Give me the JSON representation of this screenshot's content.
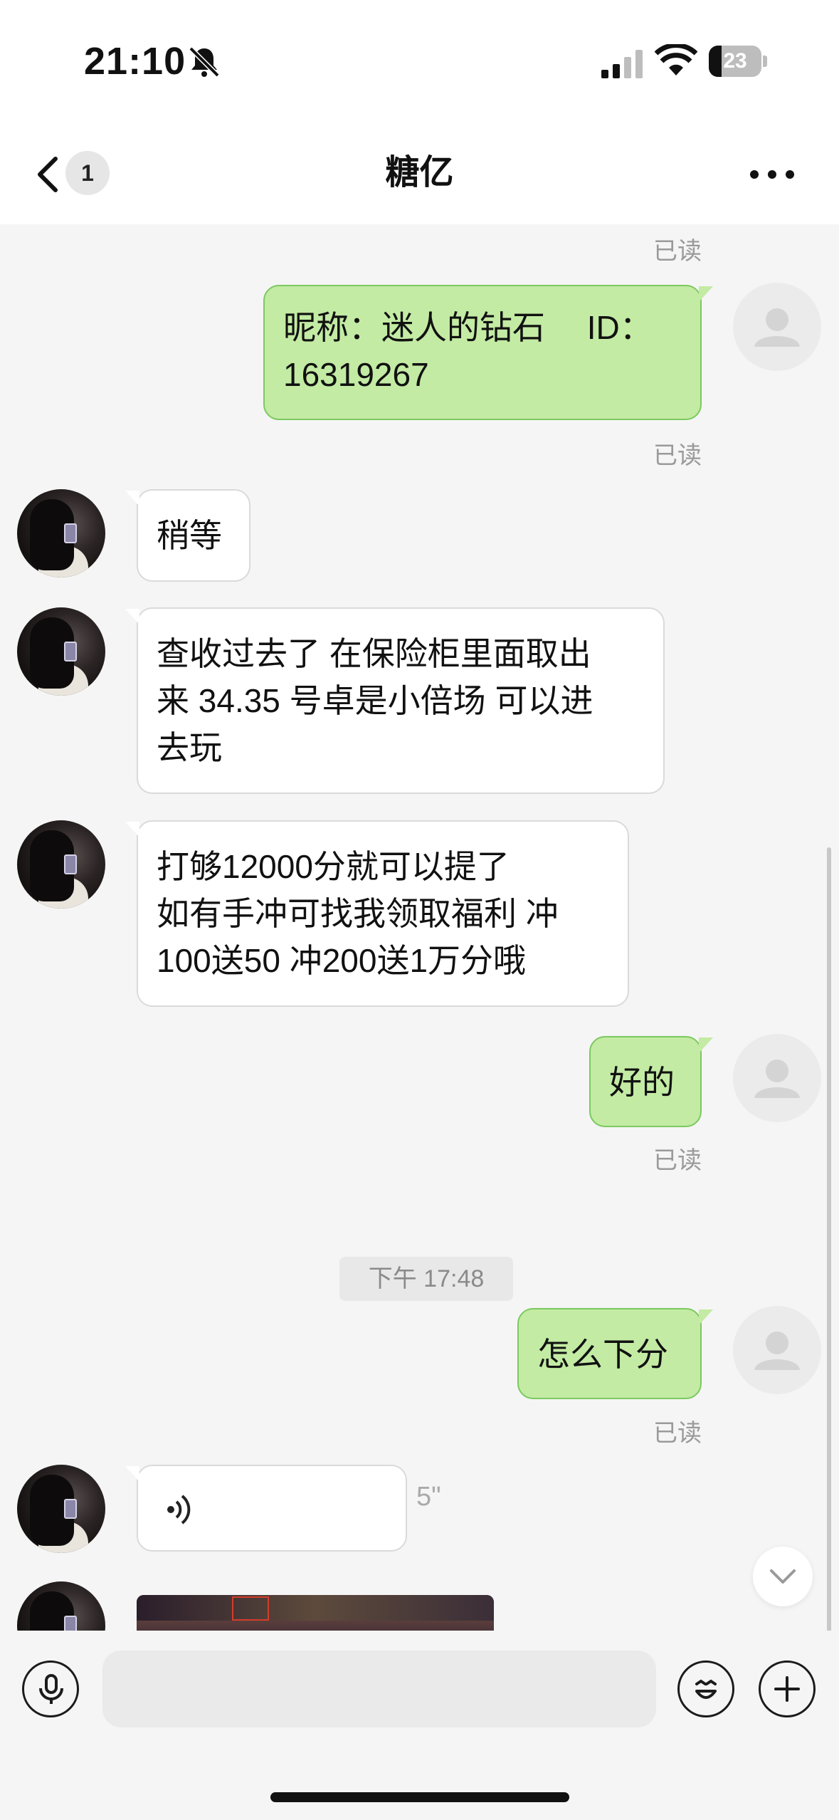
{
  "status": {
    "time": "21:10",
    "battery": "23",
    "icons": [
      "bell-slash-icon",
      "signal-icon",
      "wifi-icon",
      "battery-icon"
    ]
  },
  "nav": {
    "unread_count": "1",
    "title": "糖亿",
    "icons": [
      "chevron-left-icon",
      "more-icon"
    ]
  },
  "read_label": "已读",
  "messages": {
    "m1": {
      "line1": "昵称：迷人的钻石　 ID：",
      "line2": "16319267"
    },
    "m2": "稍等",
    "m3": {
      "line1": "查收过去了  在保险柜里面取出",
      "line2": "来 34.35 号卓是小倍场 可以进",
      "line3": "去玩"
    },
    "m4": {
      "line1": "打够12000分就可以提了",
      "line2": "如有手冲可找我领取福利  冲",
      "line3": "100送50  冲200送1万分哦"
    },
    "m5": "好的",
    "timestamp": "下午 17:48",
    "m6": "怎么下分",
    "voice": {
      "duration": "5\""
    }
  },
  "input": {
    "placeholder": "",
    "icons": [
      "microphone-icon",
      "emoji-icon",
      "plus-icon"
    ]
  }
}
